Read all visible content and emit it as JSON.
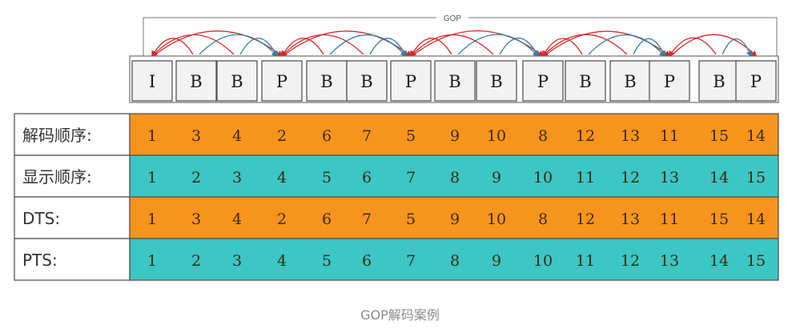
{
  "gop_label": "GOP",
  "frames": [
    "I",
    "B",
    "B",
    "P",
    "B",
    "B",
    "P",
    "B",
    "B",
    "P",
    "B",
    "B",
    "P",
    "B",
    "P"
  ],
  "rows": [
    {
      "label": "解码顺序:",
      "color": "#f7941d",
      "values": [
        "1",
        "3",
        "4",
        "2",
        "6",
        "7",
        "5",
        "9",
        "10",
        "8",
        "12",
        "13",
        "11",
        "15",
        "14"
      ]
    },
    {
      "label": "显示顺序:",
      "color": "#3cc6c4",
      "values": [
        "1",
        "2",
        "3",
        "4",
        "5",
        "6",
        "7",
        "8",
        "9",
        "10",
        "11",
        "12",
        "13",
        "14",
        "15"
      ]
    },
    {
      "label": "DTS:",
      "color": "#f7941d",
      "values": [
        "1",
        "3",
        "4",
        "2",
        "6",
        "7",
        "5",
        "9",
        "10",
        "8",
        "12",
        "13",
        "11",
        "15",
        "14"
      ]
    },
    {
      "label": "PTS:",
      "color": "#3cc6c4",
      "values": [
        "1",
        "2",
        "3",
        "4",
        "5",
        "6",
        "7",
        "8",
        "9",
        "10",
        "11",
        "12",
        "13",
        "14",
        "15"
      ]
    }
  ],
  "arcs": [
    {
      "from": 0,
      "to": 3,
      "color": "#d42a2a"
    },
    {
      "from": 1,
      "to": 0,
      "color": "#d42a2a"
    },
    {
      "from": 2,
      "to": 0,
      "color": "#d42a2a"
    },
    {
      "from": 1,
      "to": 3,
      "color": "#3a7ca5"
    },
    {
      "from": 2,
      "to": 3,
      "color": "#3a7ca5"
    },
    {
      "from": 3,
      "to": 6,
      "color": "#d42a2a"
    },
    {
      "from": 4,
      "to": 3,
      "color": "#d42a2a"
    },
    {
      "from": 5,
      "to": 3,
      "color": "#d42a2a"
    },
    {
      "from": 4,
      "to": 6,
      "color": "#3a7ca5"
    },
    {
      "from": 5,
      "to": 6,
      "color": "#3a7ca5"
    },
    {
      "from": 6,
      "to": 9,
      "color": "#d42a2a"
    },
    {
      "from": 7,
      "to": 6,
      "color": "#d42a2a"
    },
    {
      "from": 8,
      "to": 6,
      "color": "#d42a2a"
    },
    {
      "from": 7,
      "to": 9,
      "color": "#3a7ca5"
    },
    {
      "from": 8,
      "to": 9,
      "color": "#3a7ca5"
    },
    {
      "from": 9,
      "to": 12,
      "color": "#d42a2a"
    },
    {
      "from": 10,
      "to": 9,
      "color": "#d42a2a"
    },
    {
      "from": 11,
      "to": 9,
      "color": "#d42a2a"
    },
    {
      "from": 10,
      "to": 12,
      "color": "#3a7ca5"
    },
    {
      "from": 11,
      "to": 12,
      "color": "#3a7ca5"
    },
    {
      "from": 12,
      "to": 14,
      "color": "#d42a2a"
    },
    {
      "from": 13,
      "to": 12,
      "color": "#d42a2a"
    },
    {
      "from": 13,
      "to": 14,
      "color": "#3a7ca5"
    }
  ],
  "caption": "GOP解码案例"
}
